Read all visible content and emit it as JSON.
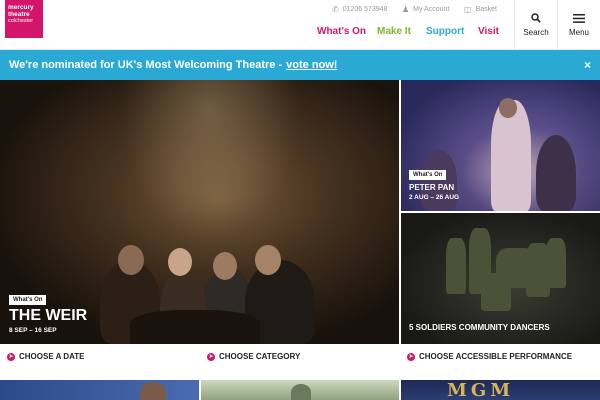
{
  "header": {
    "logo": {
      "line1": "mercury",
      "line2": "theatre",
      "line3": "colchester"
    },
    "utility": [
      {
        "icon": "phone-icon",
        "label": "01206 573948"
      },
      {
        "icon": "user-icon",
        "label": "My Account"
      },
      {
        "icon": "basket-icon",
        "label": "Basket"
      }
    ],
    "nav": [
      {
        "label": "What's On",
        "color": "#d3166b"
      },
      {
        "label": "Make It",
        "color": "#7ab929"
      },
      {
        "label": "Support",
        "color": "#2aa9d4"
      },
      {
        "label": "Visit",
        "color": "#d3166b"
      }
    ],
    "search_label": "Search",
    "menu_label": "Menu"
  },
  "banner": {
    "text": "We're nominated for UK's Most Welcoming Theatre -",
    "link": "vote now!",
    "close": "×",
    "color": "#2aa9d4"
  },
  "tiles": {
    "main": {
      "tag": "What's On",
      "title": "THE WEIR",
      "date": "8 SEP – 16 SEP"
    },
    "peter": {
      "tag": "What's On",
      "title": "PETER PAN",
      "date": "2 AUG – 26 AUG"
    },
    "soldiers": {
      "title": "5 SOLDIERS COMMUNITY DANCERS"
    }
  },
  "choose": [
    {
      "label": "CHOOSE A DATE"
    },
    {
      "label": "CHOOSE CATEGORY"
    },
    {
      "label": "CHOOSE ACCESSIBLE PERFORMANCE"
    }
  ],
  "bottom": {
    "mgm_text": "MGM"
  }
}
